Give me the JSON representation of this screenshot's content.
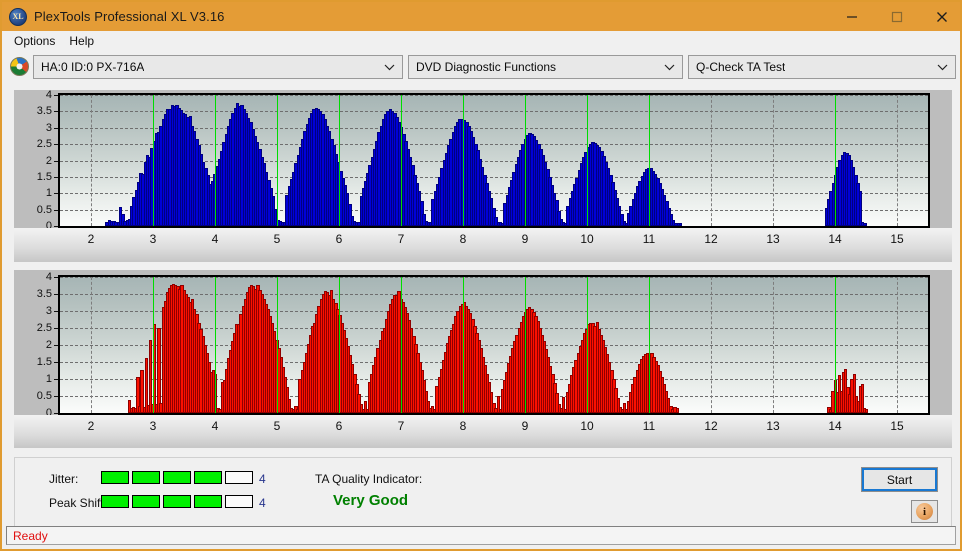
{
  "window": {
    "title": "PlexTools Professional XL V3.16",
    "logo_text": "XL",
    "minimize_label": "minimize",
    "maximize_label": "maximize",
    "close_label": "close"
  },
  "menu": {
    "items": [
      {
        "label": "Options"
      },
      {
        "label": "Help"
      }
    ]
  },
  "selectors": {
    "drive": {
      "value": "HA:0 ID:0  PX-716A",
      "icon": "disc-icon"
    },
    "function": {
      "value": "DVD Diagnostic Functions"
    },
    "test": {
      "value": "Q-Check TA Test"
    }
  },
  "indicators": {
    "jitter_label": "Jitter:",
    "jitter_value": "4",
    "jitter_filled": 4,
    "jitter_total": 5,
    "peakshift_label": "Peak Shift:",
    "peakshift_value": "4",
    "peakshift_filled": 4,
    "peakshift_total": 5,
    "ta_quality_label": "TA Quality Indicator:",
    "ta_quality_value": "Very Good",
    "ta_quality_color": "#008000",
    "start_label": "Start",
    "info_label": "i"
  },
  "status": {
    "text": "Ready"
  },
  "chart_data": [
    {
      "id": "jitter-chart",
      "type": "bar",
      "title": "",
      "xlabel": "",
      "ylabel": "",
      "color": "#0000d8",
      "edge_color": "#000080",
      "ylim": [
        0,
        4
      ],
      "yticks": [
        0,
        0.5,
        1,
        1.5,
        2,
        2.5,
        3,
        3.5,
        4
      ],
      "ytick_labels": [
        "0",
        "0.5",
        "1",
        "1.5",
        "2",
        "2.5",
        "3",
        "3.5",
        "4"
      ],
      "xlim": [
        1.5,
        15.5
      ],
      "xticks": [
        2,
        3,
        4,
        5,
        6,
        7,
        8,
        9,
        10,
        11,
        12,
        13,
        14,
        15
      ],
      "xtick_labels": [
        "2",
        "3",
        "4",
        "5",
        "6",
        "7",
        "8",
        "9",
        "10",
        "11",
        "12",
        "13",
        "14",
        "15"
      ],
      "grid": true,
      "markers": [
        3,
        4,
        5,
        6,
        7,
        8,
        9,
        10,
        11,
        14
      ],
      "values": [
        0,
        0,
        0,
        0,
        0,
        0,
        0,
        0,
        0,
        0,
        0,
        0,
        0,
        0,
        0,
        0,
        0,
        0,
        0,
        0,
        0.05,
        0.12,
        0.08,
        0.1,
        0.06,
        0.07,
        0.52,
        0.3,
        0.1,
        0.12,
        0.14,
        0.55,
        0.82,
        1.05,
        1.28,
        1.55,
        1.52,
        1.9,
        2.1,
        2.05,
        2.32,
        2.55,
        2.78,
        2.8,
        3.0,
        3.2,
        3.35,
        3.5,
        3.52,
        3.63,
        3.6,
        3.62,
        3.55,
        3.48,
        3.4,
        3.35,
        3.28,
        3.3,
        3.0,
        2.85,
        2.6,
        2.4,
        2.15,
        1.9,
        1.7,
        1.5,
        1.22,
        1.32,
        1.52,
        1.78,
        2.0,
        2.22,
        2.5,
        2.75,
        3.0,
        3.2,
        3.4,
        3.55,
        3.68,
        3.6,
        3.62,
        3.5,
        3.4,
        3.25,
        3.1,
        2.9,
        2.7,
        2.5,
        2.3,
        2.05,
        1.85,
        1.6,
        1.35,
        1.1,
        0.85,
        0.45,
        0.12,
        0.08,
        0.05,
        0.06,
        0.9,
        1.15,
        1.38,
        1.6,
        1.85,
        2.1,
        2.35,
        2.6,
        2.85,
        3.05,
        3.25,
        3.4,
        3.5,
        3.55,
        3.5,
        3.45,
        3.35,
        3.2,
        3.0,
        2.85,
        2.6,
        2.4,
        2.15,
        1.9,
        1.62,
        1.4,
        1.18,
        0.95,
        0.6,
        0.25,
        0.08,
        0.06,
        0.05,
        0.85,
        1.1,
        1.3,
        1.55,
        1.8,
        2.05,
        2.3,
        2.55,
        2.8,
        3.0,
        3.2,
        3.35,
        3.45,
        3.5,
        3.45,
        3.38,
        3.28,
        3.12,
        2.95,
        2.75,
        2.52,
        2.3,
        2.05,
        1.8,
        1.5,
        1.25,
        1.0,
        0.7,
        0.3,
        0.08,
        0.05,
        0.05,
        0.75,
        1.0,
        1.22,
        1.45,
        1.7,
        1.95,
        2.18,
        2.4,
        2.6,
        2.82,
        3.0,
        3.12,
        3.2,
        3.22,
        3.18,
        3.1,
        3.0,
        2.85,
        2.65,
        2.45,
        2.25,
        2.0,
        1.75,
        1.5,
        1.25,
        1.0,
        0.8,
        0.5,
        0.2,
        0.06,
        0.05,
        0.04,
        0.65,
        0.9,
        1.12,
        1.35,
        1.6,
        1.82,
        2.05,
        2.25,
        2.45,
        2.6,
        2.72,
        2.78,
        2.75,
        2.68,
        2.58,
        2.45,
        2.3,
        2.1,
        1.9,
        1.68,
        1.45,
        1.2,
        0.95,
        0.72,
        0.4,
        0.15,
        0.05,
        0.04,
        0.55,
        0.8,
        1.0,
        1.22,
        1.42,
        1.65,
        1.85,
        2.05,
        2.2,
        2.35,
        2.45,
        2.5,
        2.48,
        2.42,
        2.35,
        2.22,
        2.08,
        1.9,
        1.7,
        1.5,
        1.28,
        1.05,
        0.8,
        0.55,
        0.3,
        0.1,
        0.04,
        0.35,
        0.55,
        0.75,
        0.95,
        1.15,
        1.32,
        1.48,
        1.6,
        1.68,
        1.72,
        1.7,
        1.62,
        1.52,
        1.4,
        1.25,
        1.08,
        0.9,
        0.7,
        0.5,
        0.3,
        0.12,
        0.04,
        0.03,
        0.03,
        0,
        0,
        0,
        0,
        0,
        0,
        0,
        0,
        0,
        0,
        0,
        0,
        0,
        0,
        0,
        0,
        0,
        0,
        0,
        0,
        0,
        0,
        0,
        0,
        0,
        0,
        0,
        0,
        0,
        0,
        0,
        0,
        0,
        0,
        0,
        0,
        0,
        0,
        0,
        0,
        0,
        0,
        0,
        0,
        0,
        0,
        0,
        0,
        0,
        0,
        0,
        0,
        0,
        0,
        0,
        0,
        0,
        0,
        0,
        0,
        0,
        0,
        0,
        0,
        0.5,
        0.75,
        1.0,
        1.25,
        1.5,
        1.75,
        1.95,
        2.1,
        2.2,
        2.18,
        2.1,
        1.95,
        1.75,
        1.5,
        1.25,
        1.0,
        0.05,
        0.04,
        0,
        0,
        0,
        0,
        0,
        0,
        0,
        0,
        0,
        0,
        0,
        0,
        0,
        0,
        0,
        0,
        0,
        0,
        0,
        0,
        0,
        0,
        0,
        0,
        0,
        0,
        0,
        0
      ]
    },
    {
      "id": "peakshift-chart",
      "type": "bar",
      "title": "",
      "xlabel": "",
      "ylabel": "",
      "color": "#fc1000",
      "edge_color": "#8f0000",
      "ylim": [
        0,
        4
      ],
      "yticks": [
        0,
        0.5,
        1,
        1.5,
        2,
        2.5,
        3,
        3.5,
        4
      ],
      "ytick_labels": [
        "0",
        "0.5",
        "1",
        "1.5",
        "2",
        "2.5",
        "3",
        "3.5",
        "4"
      ],
      "xlim": [
        1.5,
        15.5
      ],
      "xticks": [
        2,
        3,
        4,
        5,
        6,
        7,
        8,
        9,
        10,
        11,
        12,
        13,
        14,
        15
      ],
      "xtick_labels": [
        "2",
        "3",
        "4",
        "5",
        "6",
        "7",
        "8",
        "9",
        "10",
        "11",
        "12",
        "13",
        "14",
        "15"
      ],
      "grid": true,
      "markers": [
        3,
        4,
        5,
        6,
        7,
        8,
        9,
        10,
        11,
        14
      ],
      "values": [
        0,
        0,
        0,
        0,
        0,
        0,
        0,
        0,
        0,
        0,
        0,
        0,
        0,
        0,
        0,
        0,
        0,
        0,
        0,
        0,
        0,
        0,
        0,
        0,
        0,
        0,
        0,
        0,
        0,
        0,
        0,
        0,
        0.32,
        0.1,
        0.12,
        0.08,
        1.0,
        0.15,
        1.22,
        0.12,
        1.55,
        0.18,
        2.1,
        0.2,
        2.55,
        0.22,
        2.45,
        0.25,
        3.05,
        3.25,
        3.5,
        3.62,
        3.7,
        3.75,
        3.72,
        3.68,
        3.6,
        3.72,
        3.55,
        3.45,
        3.35,
        3.2,
        3.3,
        3.0,
        2.85,
        2.6,
        2.4,
        2.2,
        1.95,
        1.7,
        1.45,
        1.15,
        1.2,
        1.1,
        0.08,
        0.05,
        0.85,
        0.9,
        1.25,
        1.55,
        1.8,
        2.05,
        2.3,
        2.55,
        2.55,
        2.85,
        3.1,
        3.3,
        3.5,
        3.65,
        3.72,
        3.68,
        3.6,
        3.72,
        3.55,
        3.45,
        3.3,
        3.15,
        3.0,
        2.8,
        2.6,
        2.35,
        2.1,
        1.85,
        1.6,
        1.3,
        1.0,
        0.7,
        0.35,
        0.1,
        0.05,
        0.15,
        0.05,
        0.95,
        1.2,
        1.45,
        1.72,
        1.98,
        2.25,
        2.5,
        2.6,
        2.85,
        3.1,
        3.3,
        3.45,
        3.52,
        3.5,
        3.42,
        3.55,
        3.3,
        3.18,
        3.0,
        2.82,
        2.6,
        2.38,
        2.15,
        1.9,
        1.65,
        1.38,
        1.1,
        0.8,
        0.5,
        0.2,
        0.06,
        0.3,
        0.06,
        0.85,
        1.1,
        1.35,
        1.6,
        1.85,
        2.1,
        2.35,
        2.45,
        2.7,
        2.95,
        3.15,
        3.3,
        3.42,
        3.4,
        3.52,
        3.3,
        3.2,
        3.05,
        2.88,
        2.68,
        2.45,
        2.22,
        1.98,
        1.72,
        1.45,
        1.2,
        0.9,
        0.6,
        0.28,
        0.08,
        0.15,
        0.05,
        0.75,
        1.0,
        1.25,
        1.5,
        1.75,
        2.0,
        2.2,
        2.38,
        2.55,
        2.78,
        2.95,
        3.1,
        3.15,
        3.2,
        3.1,
        3.0,
        2.88,
        2.7,
        2.5,
        2.3,
        2.08,
        1.85,
        1.6,
        1.35,
        1.1,
        0.85,
        0.55,
        0.25,
        0.08,
        0.45,
        0.06,
        0.65,
        0.9,
        1.15,
        1.4,
        1.62,
        1.85,
        2.05,
        2.25,
        2.45,
        2.62,
        2.78,
        2.9,
        3.0,
        3.05,
        3.0,
        2.9,
        2.8,
        2.65,
        2.45,
        2.25,
        2.05,
        1.82,
        1.58,
        1.32,
        1.08,
        0.82,
        0.52,
        0.22,
        0.08,
        0.4,
        0.05,
        0.55,
        0.8,
        1.05,
        1.28,
        1.5,
        1.72,
        1.92,
        2.1,
        2.28,
        2.42,
        2.55,
        2.6,
        2.58,
        2.5,
        2.62,
        2.4,
        2.25,
        2.08,
        1.88,
        1.68,
        1.45,
        1.2,
        0.95,
        0.68,
        0.38,
        0.12,
        0.06,
        0.25,
        0.05,
        0.3,
        0.55,
        0.8,
        1.0,
        1.2,
        1.38,
        1.52,
        1.62,
        1.68,
        1.72,
        1.7,
        1.7,
        1.6,
        1.48,
        1.35,
        1.18,
        1.0,
        0.8,
        0.6,
        0.38,
        0.15,
        0.05,
        0.12,
        0.1,
        0,
        0,
        0,
        0,
        0,
        0,
        0,
        0,
        0,
        0,
        0,
        0,
        0,
        0,
        0,
        0,
        0,
        0,
        0,
        0,
        0,
        0,
        0,
        0,
        0,
        0,
        0,
        0,
        0,
        0,
        0,
        0,
        0,
        0,
        0,
        0,
        0,
        0,
        0,
        0,
        0,
        0,
        0,
        0,
        0,
        0,
        0,
        0,
        0,
        0,
        0,
        0,
        0,
        0,
        0,
        0,
        0,
        0,
        0,
        0,
        0,
        0,
        0,
        0,
        0,
        0,
        0,
        0,
        0,
        0,
        0,
        0.12,
        0.05,
        0.6,
        0.9,
        0.55,
        1.05,
        0.6,
        1.15,
        1.25,
        0.7,
        0.5,
        0.95,
        1.1,
        0.45,
        0.3,
        0.75,
        0.8,
        0.1,
        0.05,
        0,
        0,
        0,
        0,
        0,
        0,
        0,
        0,
        0,
        0,
        0,
        0,
        0,
        0,
        0,
        0,
        0,
        0,
        0,
        0,
        0,
        0,
        0,
        0,
        0,
        0,
        0,
        0,
        0
      ]
    }
  ]
}
